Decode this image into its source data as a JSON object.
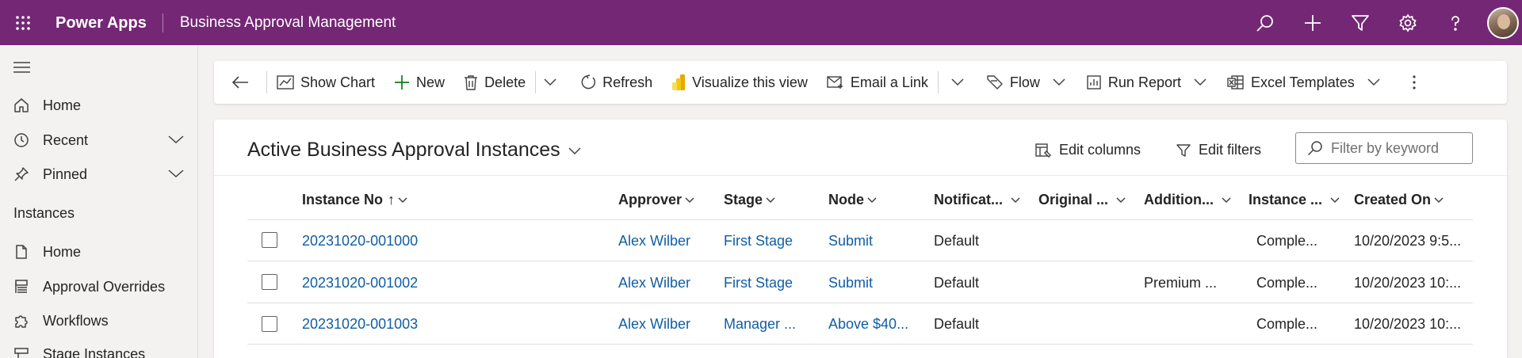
{
  "topbar": {
    "app_name": "Power Apps",
    "app_title": "Business Approval Management",
    "icons": [
      "app-launcher-icon",
      "search-icon",
      "plus-icon",
      "filter-icon",
      "gear-icon",
      "help-icon",
      "avatar"
    ],
    "color": "#742774"
  },
  "sidebar": {
    "items": [
      {
        "label": "Home",
        "icon": "home-icon"
      },
      {
        "label": "Recent",
        "icon": "clock-icon"
      },
      {
        "label": "Pinned",
        "icon": "pin-icon"
      }
    ],
    "section_header": "Instances",
    "section_items": [
      {
        "label": "Home",
        "icon": "document-icon"
      },
      {
        "label": "Approval Overrides",
        "icon": "override-icon"
      },
      {
        "label": "Workflows",
        "icon": "puzzle-icon"
      },
      {
        "label": "Stage Instances",
        "icon": "stage-icon"
      }
    ]
  },
  "commandbar": {
    "show_chart": "Show Chart",
    "new": "New",
    "delete": "Delete",
    "refresh": "Refresh",
    "visualize": "Visualize this view",
    "email_link": "Email a Link",
    "flow": "Flow",
    "run_report": "Run Report",
    "excel_templates": "Excel Templates"
  },
  "view": {
    "title": "Active Business Approval Instances",
    "edit_columns": "Edit columns",
    "edit_filters": "Edit filters",
    "filter_placeholder": "Filter by keyword"
  },
  "grid": {
    "columns": [
      "Instance No",
      "Approver",
      "Stage",
      "Node",
      "Notificat...",
      "Original ...",
      "Addition...",
      "Instance ...",
      "Created On"
    ],
    "sort_indicator": "↑",
    "rows": [
      {
        "instance_no": "20231020-001000",
        "approver": "Alex Wilber",
        "stage": "First Stage",
        "node": "Submit",
        "notification": "Default",
        "original": "",
        "additional": "",
        "instance_status": "Comple...",
        "created_on": "10/20/2023 9:5..."
      },
      {
        "instance_no": "20231020-001002",
        "approver": "Alex Wilber",
        "stage": "First Stage",
        "node": "Submit",
        "notification": "Default",
        "original": "",
        "additional": "Premium ...",
        "instance_status": "Comple...",
        "created_on": "10/20/2023 10:..."
      },
      {
        "instance_no": "20231020-001003",
        "approver": "Alex Wilber",
        "stage": "Manager ...",
        "node": "Above $40...",
        "notification": "Default",
        "original": "",
        "additional": "",
        "instance_status": "Comple...",
        "created_on": "10/20/2023 10:..."
      }
    ]
  },
  "colors": {
    "link": "#115ea3",
    "accent": "#742774",
    "new_plus": "#107c10"
  }
}
